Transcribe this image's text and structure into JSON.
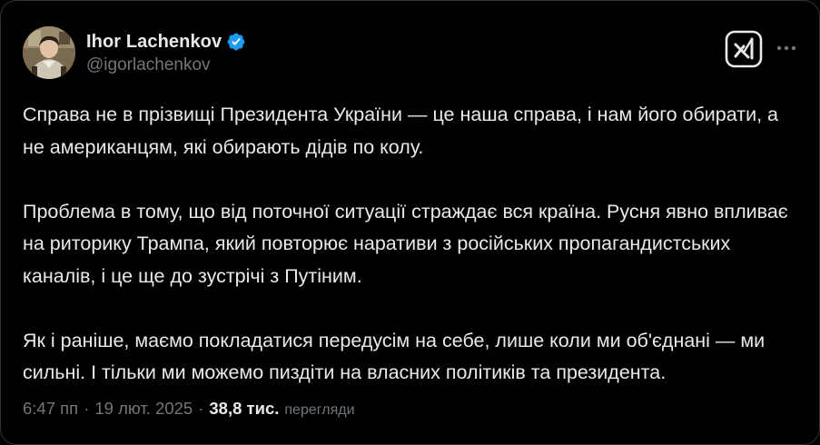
{
  "author": {
    "display_name": "Ihor Lachenkov",
    "handle": "@igorlachenkov",
    "verified_icon": "verified-badge-icon",
    "avatar_icon": "user-avatar"
  },
  "actions": {
    "grok_icon": "grok-logo-icon",
    "more_icon": "more-horizontal-icon"
  },
  "tweet": {
    "paragraphs": [
      "Справа не в прізвищі Президента України — це наша справа, і нам його обирати, а не американцям, які обирають дідів по колу.",
      "Проблема в тому, що від поточної ситуації страждає вся країна. Русня явно впливає на риторику Трампа, який повторює наративи з російських пропагандистських каналів, і це ще до зустрічі з Путіним.",
      "Як і раніше, маємо покладатися передусім на себе, лише коли ми об'єднані — ми сильні. І тільки ми можемо пиздіти на власних політиків та президента."
    ]
  },
  "meta": {
    "time": "6:47 пп",
    "separator": "·",
    "date": "19 лют. 2025",
    "views_count": "38,8 тис.",
    "views_label": "перегляди"
  },
  "colors": {
    "background": "#000000",
    "text_primary": "#e7e9ea",
    "text_secondary": "#71767b",
    "verified_blue": "#1d9bf0",
    "border": "#2f3336"
  }
}
